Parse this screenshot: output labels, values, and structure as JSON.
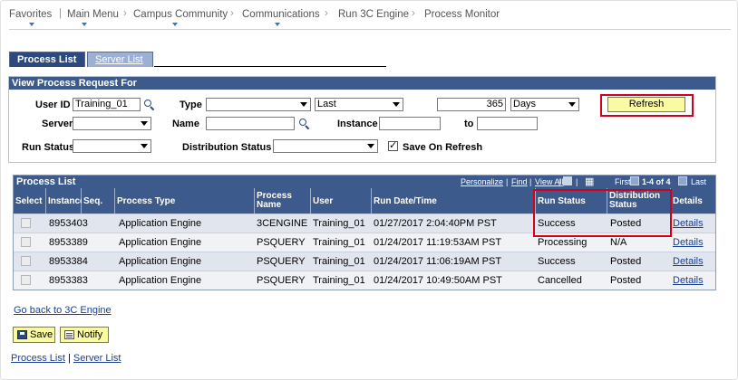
{
  "breadcrumb": {
    "items": [
      "Favorites",
      "Main Menu",
      "Campus Community",
      "Communications",
      "Run 3C Engine",
      "Process Monitor"
    ]
  },
  "tabs": {
    "process_list": "Process List",
    "server_list": "Server List"
  },
  "request": {
    "header": "View Process Request For",
    "user_id_label": "User ID",
    "user_id_value": "Training_01",
    "type_label": "Type",
    "type_value": "",
    "period_value": "Last",
    "period_count": "365",
    "period_unit": "Days",
    "refresh_label": "Refresh",
    "server_label": "Server",
    "server_value": "",
    "name_label": "Name",
    "name_value": "",
    "instance_label": "Instance",
    "instance_from": "",
    "to_label": "to",
    "instance_to": "",
    "run_status_label": "Run Status",
    "run_status_value": "",
    "dist_status_label": "Distribution Status",
    "dist_status_value": "",
    "save_on_refresh_label": "Save On Refresh",
    "save_on_refresh_checked": true
  },
  "grid": {
    "title": "Process List",
    "personalize": "Personalize",
    "find": "Find",
    "view_all": "View All",
    "first": "First",
    "range": "1-4 of 4",
    "last": "Last",
    "columns": {
      "select": "Select",
      "instance": "Instance",
      "seq": "Seq.",
      "process_type": "Process Type",
      "process_name_1": "Process",
      "process_name_2": "Name",
      "user": "User",
      "run_datetime": "Run Date/Time",
      "run_status": "Run Status",
      "dist_status_1": "Distribution",
      "dist_status_2": "Status",
      "details": "Details"
    },
    "rows": [
      {
        "instance": "8953403",
        "seq": "",
        "process_type": "Application Engine",
        "process_name": "3CENGINE",
        "user": "Training_01",
        "run_datetime": "01/27/2017  2:04:40PM PST",
        "run_status": "Success",
        "dist_status": "Posted",
        "details": "Details"
      },
      {
        "instance": "8953389",
        "seq": "",
        "process_type": "Application Engine",
        "process_name": "PSQUERY",
        "user": "Training_01",
        "run_datetime": "01/24/2017 11:19:53AM PST",
        "run_status": "Processing",
        "dist_status": "N/A",
        "details": "Details"
      },
      {
        "instance": "8953384",
        "seq": "",
        "process_type": "Application Engine",
        "process_name": "PSQUERY",
        "user": "Training_01",
        "run_datetime": "01/24/2017 11:06:19AM PST",
        "run_status": "Success",
        "dist_status": "Posted",
        "details": "Details"
      },
      {
        "instance": "8953383",
        "seq": "",
        "process_type": "Application Engine",
        "process_name": "PSQUERY",
        "user": "Training_01",
        "run_datetime": "01/24/2017 10:49:50AM PST",
        "run_status": "Cancelled",
        "dist_status": "Posted",
        "details": "Details"
      }
    ]
  },
  "footer": {
    "go_back": "Go back to 3C Engine",
    "save": "Save",
    "notify": "Notify",
    "link_process_list": "Process List",
    "link_separator": " | ",
    "link_server_list": "Server List"
  },
  "colors": {
    "header_blue": "#3d5a8c",
    "tab_active": "#2c4a80",
    "button_yellow": "#fafaa2",
    "highlight_red": "#d0021b",
    "link_blue": "#1a3f8e"
  }
}
